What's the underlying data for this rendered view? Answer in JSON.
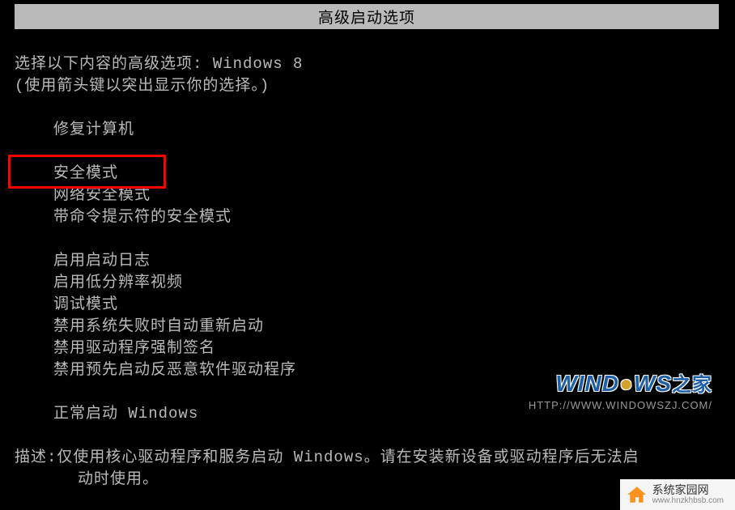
{
  "title": "高级启动选项",
  "instruction1_prefix": "选择以下内容的高级选项: ",
  "instruction1_os": "Windows 8",
  "instruction2": "(使用箭头键以突出显示你的选择。)",
  "menu": {
    "repair": "修复计算机",
    "safe_mode": "安全模式",
    "safe_mode_network": "网络安全模式",
    "safe_mode_cmd": "带命令提示符的安全模式",
    "boot_log": "启用启动日志",
    "low_res": "启用低分辨率视频",
    "debug": "调试模式",
    "disable_restart": "禁用系统失败时自动重新启动",
    "disable_driver_sig": "禁用驱动程序强制签名",
    "disable_antimalware": "禁用预先启动反恶意软件驱动程序",
    "normal": "正常启动 Windows"
  },
  "description": {
    "label": "描述: ",
    "text1": "仅使用核心驱动程序和服务启动 Windows。请在安装新设备或驱动程序后无法启",
    "text2": "动时使用。"
  },
  "watermark": {
    "windows_brand": "WIND",
    "windows_brand2": "WS",
    "windows_zhijia": "之家",
    "windows_url": "HTTP://WWW.WINDOWSZJ.COM/",
    "site_name": "系统家园网",
    "site_url": "www.hnzkhbsb.com"
  }
}
